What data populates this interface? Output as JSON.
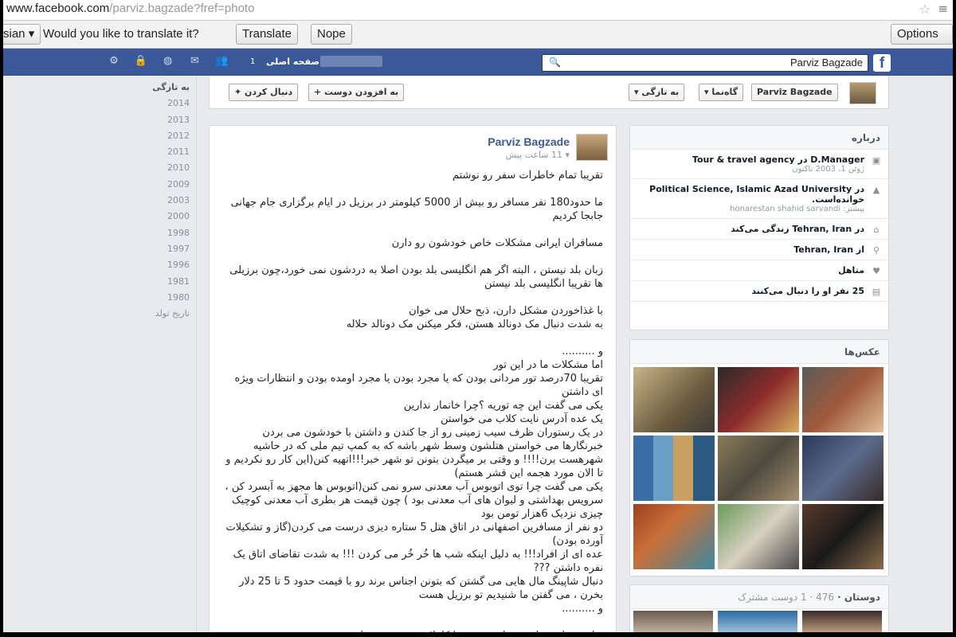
{
  "browser": {
    "url_main": "www.facebook.com",
    "url_rest": "/parviz.bagzade?fref=photo"
  },
  "translate_bar": {
    "language": "sian",
    "question": "Would you like to translate it?",
    "translate_label": "Translate",
    "nope_label": "Nope",
    "options_label": "Options"
  },
  "fb_header": {
    "logo": "f",
    "search_value": "Parviz Bagzade",
    "home_label": "صفحه اصلی",
    "home_count": "1"
  },
  "timeline_years": [
    "به تازگی",
    "2014",
    "2013",
    "2012",
    "2011",
    "2010",
    "2009",
    "2003",
    "2000",
    "1998",
    "1997",
    "1996",
    "1981",
    "1980",
    "تاریخ تولد"
  ],
  "profile_strip": {
    "name_button": "Parviz Bagzade",
    "timeline_button": "گاه‌نما",
    "recent_button": "به تازگی",
    "add_friend": "به افزودن دوست",
    "follow": "دنبال کردن"
  },
  "post": {
    "author": "Parviz Bagzade",
    "time": "11 ساعت پیش",
    "paragraphs": [
      "تقریبا تمام خاطرات سفر رو نوشتم",
      "ما حدود180 نفر مسافر رو بیش از 5000 کیلومتر در برزیل در ایام برگزاری جام جهانی جابجا کردیم",
      "مسافران ایرانی مشکلات خاص خودشون رو دارن",
      "زبان بلد نیستن ، البته اگر هم انگلیسی بلد بودن اصلا به دردشون نمی خورد،چون برزیلی ها تقریبا انگلیسی بلد نیستن",
      "با غذاخوردن مشکل دارن، ذبح حلال می خوان\nبه شدت دنبال مک دونالد هستن، فکر میکنن مک دونالد حلاله",
      "و ..........\nاما مشکلات ما در این تور\nتقریبا 70درصد تور مردانی بودن که یا مجرد بودن یا مجرد اومده بودن و انتظارات ویژه ای داشتن\nیکی می گفت این چه توریه ؟چرا خانمار ندارین\nیک عده آدرس نایت کلاب می خواستن\nدر یک رستوران ظرف سیب زمینی رو از جا کندن و داشتن با خودشون می بردن\nخبرنگارها می خواستن هتلشون وسط شهر باشه که به کمپ تیم ملی که در حاشیه شهرهست برن!!!! و وقتی بر میگردن بتونن تو شهر خبر!!!اتهیه کنن(این کار رو نکردیم و تا الان مورد هجمه این قشر هستم)\nیکی می گفت چرا توی اتوبوس آب معدنی سرو نمی کنن(اتوبوس ها مجهز به آبسرد کن ، سرویس بهداشتی و لیوان های آب معدنی بود ) چون قیمت هر بطری آب معدنی کوچیک چیزی نزدیک 6هزار تومن بود\nدو نفر از مسافرین اصفهانی در اتاق هتل 5 ستاره دیزی درست می کردن(گاز و تشکیلات آورده بودن)\nعده ای از افراد!!! به دلیل اینکه شب ها خُر خُر می کردن !!! به شدت تقاضای اتاق یک نفره داشتن ???\nدنبال شاپینگ مال هایی می گشتن که بتونن اجناس برند رو با قیمت حدود 5 تا 25 دلار بخرن ، می گفتن ما شنیدیم تو برزیل هست\nو ..........",
      "تفاوت سلیقه ها بین خیلی مذهبی تا کاملا غیر مذهبی متفاوت بود"
    ]
  },
  "about": {
    "header": "درباره",
    "rows": [
      {
        "icon": "briefcase-icon",
        "text": "D.Manager در Tour & travel agency",
        "sub": "ژوئن 1، 2003 تاکنون"
      },
      {
        "icon": "graduation-icon",
        "text": "در Political Science, Islamic Azad University خوانده‌است.",
        "sub": "پیشتر: honarestan shahid sarvandi"
      },
      {
        "icon": "home-icon",
        "text": "در Tehran, Iran زندگی می‌کند",
        "sub": ""
      },
      {
        "icon": "location-icon",
        "text": "از Tehran, Iran",
        "sub": ""
      },
      {
        "icon": "heart-icon",
        "text": "متاهل",
        "sub": ""
      },
      {
        "icon": "followers-icon",
        "text": "25 نفر او را دنبال می‌کنند",
        "sub": ""
      }
    ]
  },
  "photos": {
    "header": "عکس‌ها"
  },
  "friends": {
    "header": "دوستان",
    "count": "476 · 1 دوست مشترک"
  }
}
